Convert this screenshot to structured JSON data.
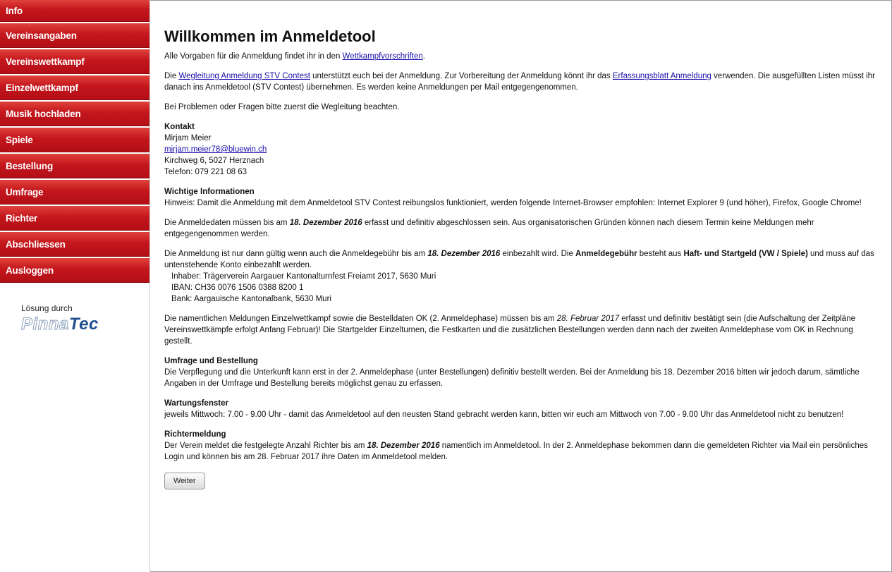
{
  "nav": [
    "Info",
    "Vereinsangaben",
    "Vereinswettkampf",
    "Einzelwettkampf",
    "Musik hochladen",
    "Spiele",
    "Bestellung",
    "Umfrage",
    "Richter",
    "Abschliessen",
    "Ausloggen"
  ],
  "sidebar": {
    "solution_label": "Lösung durch",
    "logo_part1": "Pinna",
    "logo_part2": "Tec"
  },
  "page": {
    "title": "Willkommen im Anmeldetool",
    "p1_pre": "Alle Vorgaben für die Anmeldung findet ihr in den ",
    "p1_link": "Wettkampfvorschriften",
    "p1_post": ".",
    "p2_pre": "Die ",
    "p2_link1": "Wegleitung Anmeldung STV Contest",
    "p2_mid": " unterstützt euch bei der Anmeldung. Zur Vorbereitung der Anmeldung könnt ihr das ",
    "p2_link2": "Erfassungsblatt Anmeldung",
    "p2_post": " verwenden. Die ausgefüllten Listen müsst ihr danach ins Anmeldetool (STV Contest) übernehmen. Es werden keine Anmeldungen per Mail entgegengenommen.",
    "p3": "Bei Problemen oder Fragen bitte zuerst die Wegleitung beachten.",
    "contact_title": "Kontakt",
    "contact_name": "Mirjam Meier",
    "contact_email": "mirjam.meier78@bluewin.ch",
    "contact_address": "Kirchweg 6, 5027 Herznach",
    "contact_phone": "Telefon: 079 221 08 63",
    "info_title": "Wichtige Informationen",
    "info_text": "Hinweis: Damit die Anmeldung mit dem Anmeldetool STV Contest reibungslos funktioniert, werden folgende Internet-Browser empfohlen: Internet Explorer 9 (und höher), Firefox, Google Chrome!",
    "deadline_pre": "Die Anmeldedaten müssen bis am ",
    "deadline_date": "18. Dezember 2016",
    "deadline_post": " erfasst und definitiv abgeschlossen sein. Aus organisatorischen Gründen können nach diesem Termin keine Meldungen mehr entgegengenommen werden.",
    "fee_pre": "Die Anmeldung ist nur dann gültig wenn auch die Anmeldegebühr bis am ",
    "fee_date": "18. Dezember 2016",
    "fee_mid": " einbezahlt wird. Die ",
    "fee_bold1": "Anmeldegebühr",
    "fee_mid2": " besteht aus ",
    "fee_bold2": "Haft- und Startgeld (VW / Spiele)",
    "fee_post": " und muss auf das untenstehende Konto einbezahlt werden.",
    "bank_owner": "Inhaber: Trägerverein Aargauer Kantonalturnfest Freiamt 2017, 5630 Muri",
    "bank_iban": "IBAN: CH36 0076 1506 0388 8200 1",
    "bank_name": "Bank: Aargauische Kantonalbank, 5630 Muri",
    "phase2_pre": "Die namentlichen Meldungen Einzelwettkampf sowie die Bestelldaten OK (2. Anmeldephase) müssen bis am ",
    "phase2_date": "28. Februar 2017",
    "phase2_post": " erfasst und definitiv bestätigt sein (die Aufschaltung der Zeitpläne Vereinswettkämpfe erfolgt Anfang Februar)! Die Startgelder Einzelturnen, die Festkarten und die zusätzlichen Bestellungen werden dann nach der zweiten Anmeldephase vom OK in Rechnung gestellt.",
    "survey_title": "Umfrage und Bestellung",
    "survey_text": "Die Verpflegung und die Unterkunft kann erst in der 2. Anmeldephase (unter Bestellungen) definitiv bestellt werden. Bei der Anmeldung bis 18. Dezember 2016 bitten wir jedoch darum, sämtliche Angaben in der Umfrage und Bestellung bereits möglichst genau zu erfassen.",
    "maint_title": "Wartungsfenster",
    "maint_text": "jeweils Mittwoch: 7.00 - 9.00 Uhr - damit das Anmeldetool auf den neusten Stand gebracht werden kann, bitten wir euch am Mittwoch von 7.00 - 9.00 Uhr das Anmeldetool nicht zu benutzen!",
    "judge_title": "Richtermeldung",
    "judge_pre": "Der Verein meldet die festgelegte Anzahl Richter bis am ",
    "judge_date": "18. Dezember 2016",
    "judge_post": " namentlich im Anmeldetool. In der 2. Anmeldephase bekommen dann die gemeldeten Richter via Mail ein persönliches Login und können bis am 28. Februar 2017 ihre Daten im Anmeldetool melden.",
    "next_button": "Weiter"
  }
}
